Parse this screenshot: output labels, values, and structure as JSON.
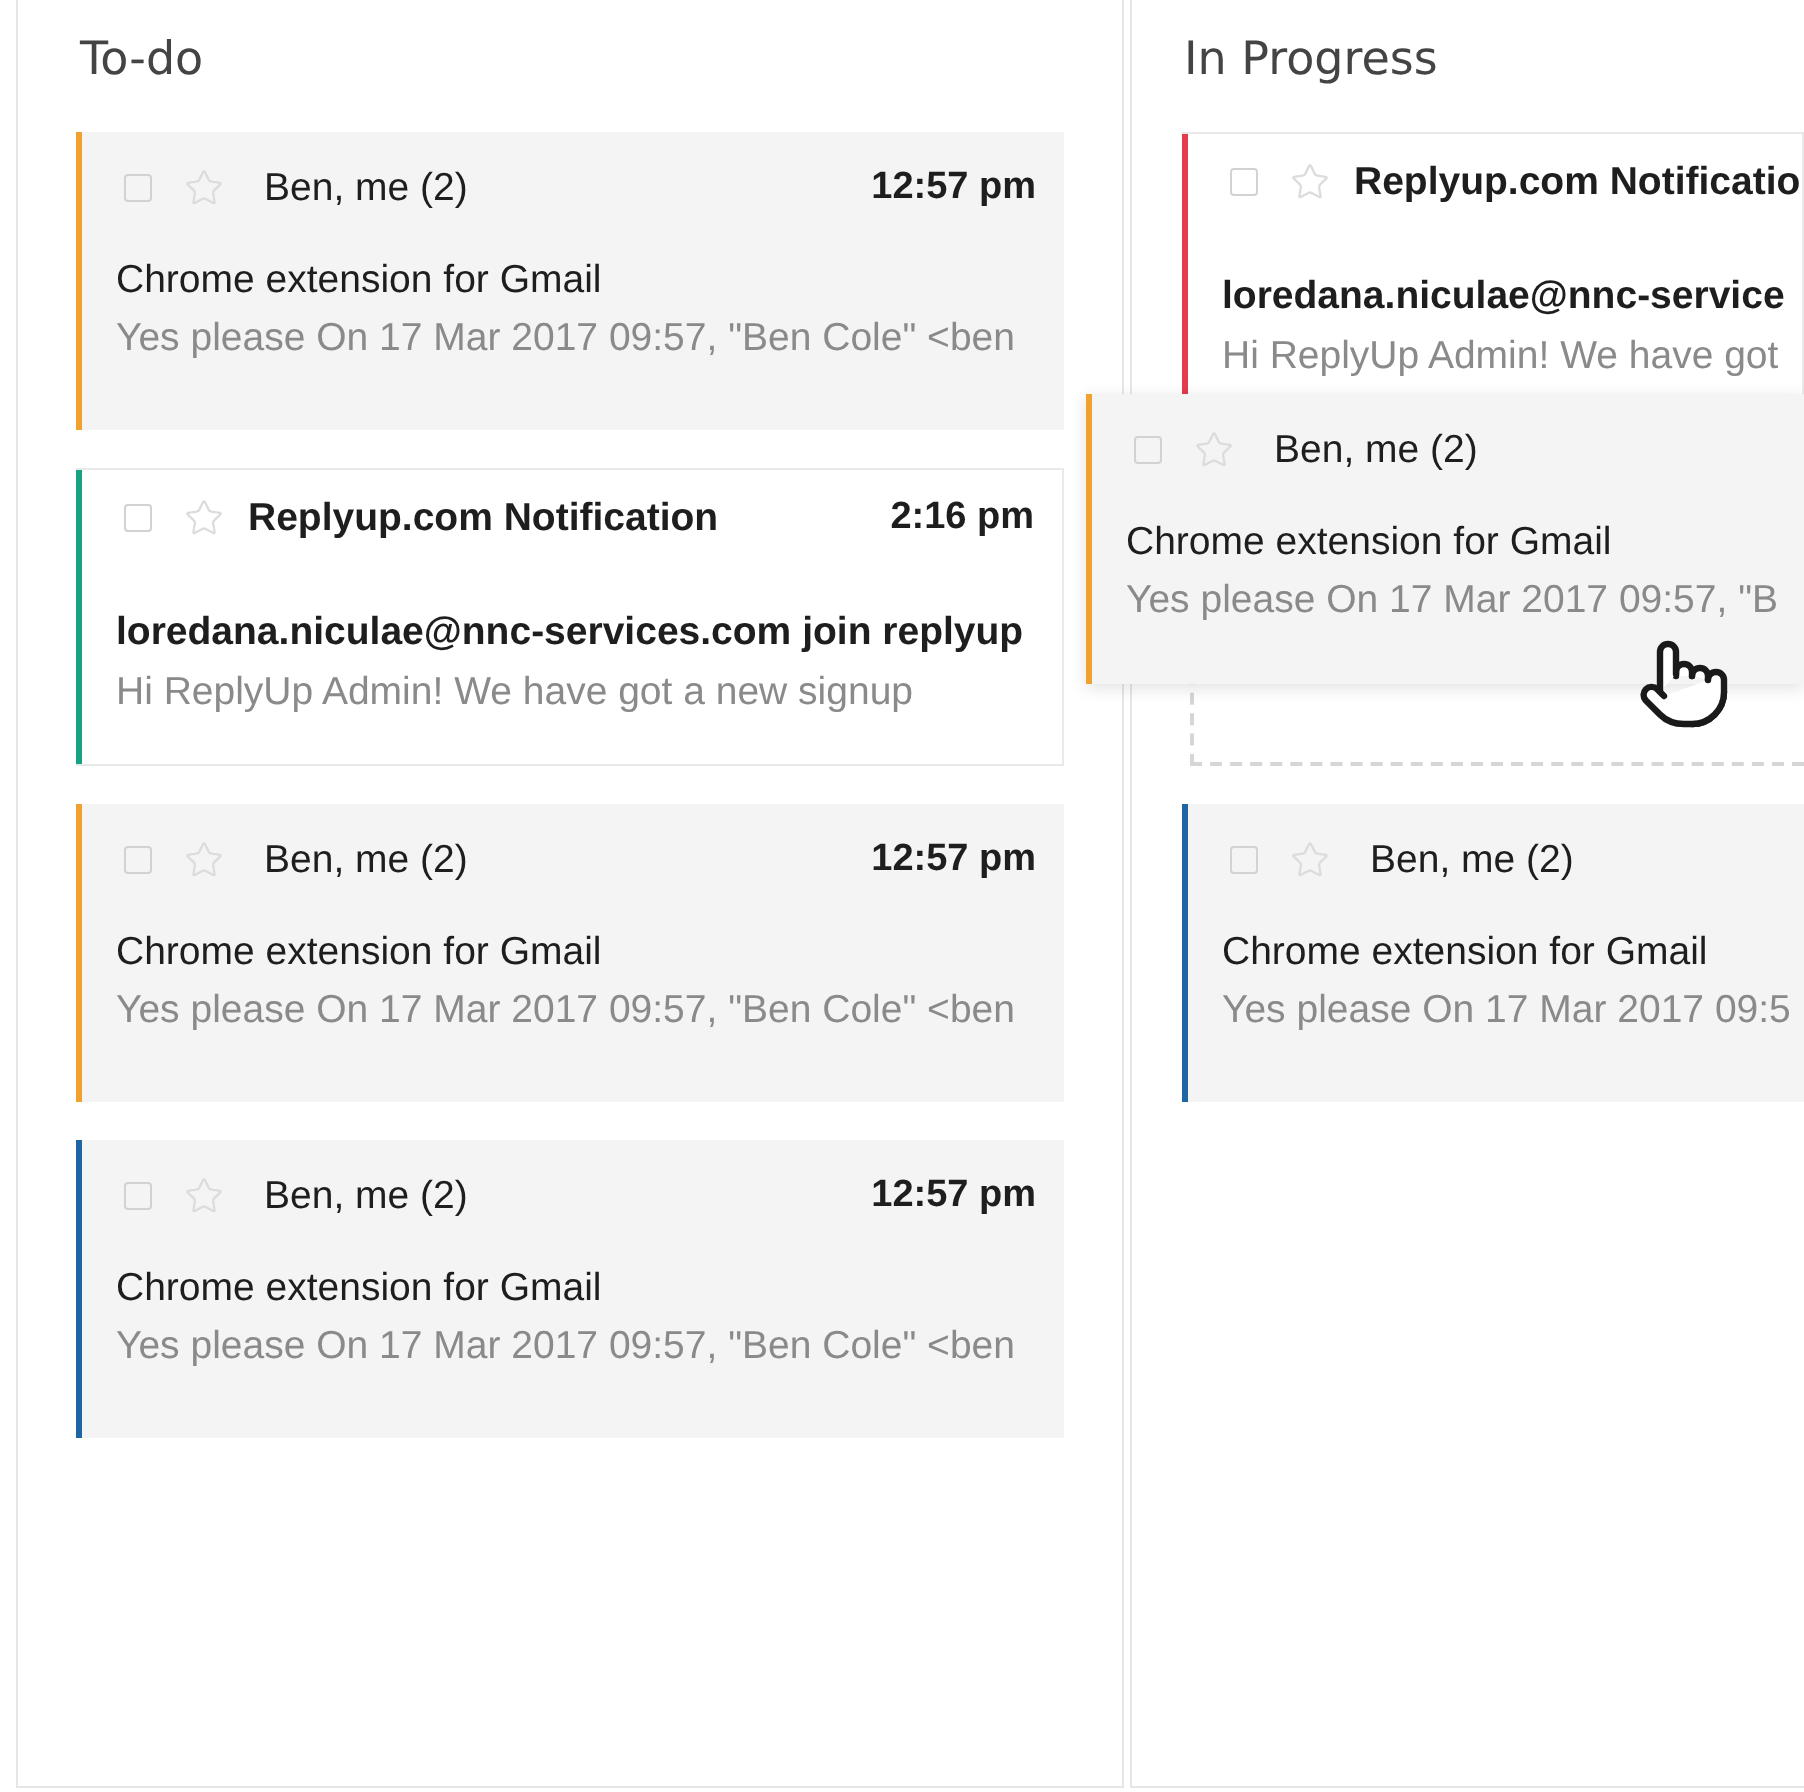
{
  "columns": [
    {
      "title": "To-do",
      "cards": [
        {
          "kind": "email",
          "color": "#f0a12f",
          "unread": false,
          "checked": false,
          "starred": false,
          "sender": "Ben, me (2)",
          "time": "12:57 pm",
          "subject": "Chrome extension for Gmail",
          "snippet": "Yes please On 17 Mar 2017 09:57, \"Ben Cole\" <ben"
        },
        {
          "kind": "email",
          "color": "#16a383",
          "unread": true,
          "checked": false,
          "starred": false,
          "sender": "Replyup.com Notification",
          "time": "2:16 pm",
          "subject": "loredana.niculae@nnc-services.com join replyup",
          "snippet": "Hi ReplyUp Admin! We have got a new signup"
        },
        {
          "kind": "email",
          "color": "#f0a12f",
          "unread": false,
          "checked": false,
          "starred": false,
          "sender": "Ben, me (2)",
          "time": "12:57 pm",
          "subject": "Chrome extension for Gmail",
          "snippet": "Yes please On 17 Mar 2017 09:57, \"Ben Cole\" <ben"
        },
        {
          "kind": "email",
          "color": "#1d66a3",
          "unread": false,
          "checked": false,
          "starred": false,
          "sender": "Ben, me (2)",
          "time": "12:57 pm",
          "subject": "Chrome extension for Gmail",
          "snippet": "Yes please On 17 Mar 2017 09:57, \"Ben Cole\" <ben"
        }
      ]
    },
    {
      "title": "In Progress",
      "cards": [
        {
          "kind": "email",
          "color": "#e53c4c",
          "unread": true,
          "checked": false,
          "starred": false,
          "sender": "Replyup.com Notificatio",
          "subject": "loredana.niculae@nnc-service",
          "snippet": "Hi ReplyUp Admin! We have got"
        },
        {
          "kind": "drop_placeholder"
        },
        {
          "kind": "email",
          "color": "#1d66a3",
          "unread": false,
          "checked": false,
          "starred": false,
          "sender": "Ben, me (2)",
          "subject": "Chrome extension for Gmail",
          "snippet": "Yes please On 17 Mar 2017 09:5"
        }
      ]
    }
  ],
  "dragged_card": {
    "color": "#f0a12f",
    "unread": false,
    "checked": false,
    "starred": false,
    "sender": "Ben, me (2)",
    "subject": "Chrome extension for Gmail",
    "snippet": "Yes please On 17 Mar 2017 09:57, \"B"
  }
}
